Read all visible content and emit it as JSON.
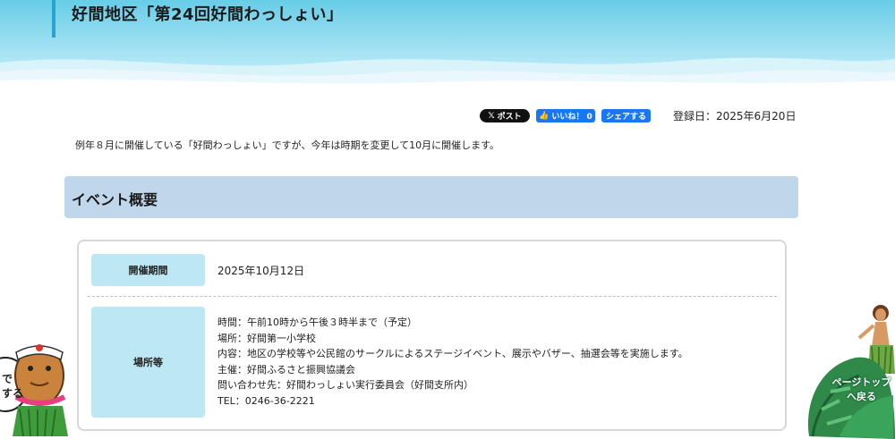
{
  "page": {
    "title": "好間地区「第24回好間わっしょい」"
  },
  "social": {
    "x_post": "ポスト",
    "like": "いいね！ 0",
    "share": "シェアする"
  },
  "registered_date": "登録日：2025年6月20日",
  "intro_text": "例年８月に開催している「好間わっしょい」ですが、今年は時期を変更して10月に開催します。",
  "section_heading": "イベント概要",
  "event": {
    "period_label": "開催期間",
    "period_value": "2025年10月12日",
    "place_label": "場所等",
    "details": [
      "時間：午前10時から午後３時半まで（予定）",
      "場所：好間第一小学校",
      "内容：地区の学校等や公民館のサークルによるステージイベント、展示やバザー、抽選会等を実施します。",
      "主催：好間ふるさと振興協議会",
      "問い合わせ先：好間わっしょい実行委員会（好間支所内）",
      "TEL：0246-36-2221"
    ]
  },
  "floating": {
    "left_snippet": [
      "で",
      "する"
    ],
    "page_top": [
      "ページトップ",
      "へ戻る"
    ]
  },
  "colors": {
    "banner_top": "#67cde6",
    "section_bg": "#c0d7eb",
    "label_bg": "#bde8f3",
    "accent_bar": "#29a3d2"
  }
}
